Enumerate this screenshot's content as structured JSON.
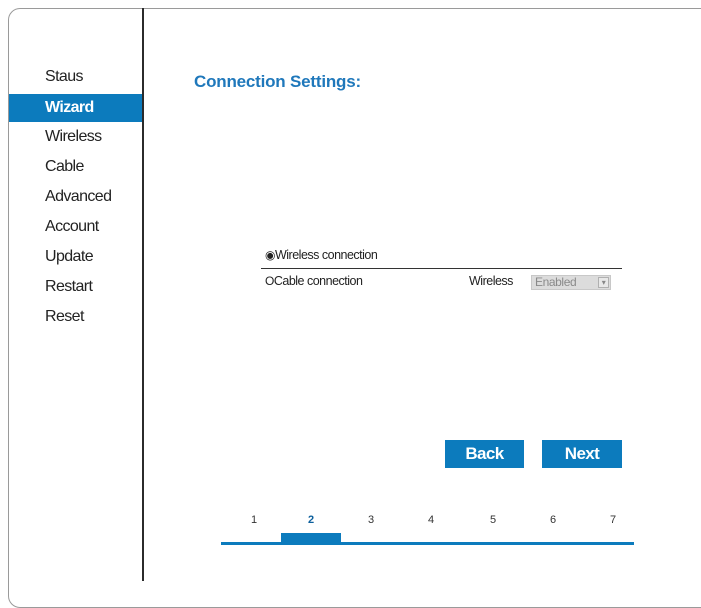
{
  "colors": {
    "accent": "#0c7bbd",
    "title": "#1f78bb",
    "select_bg": "#dcdcdc"
  },
  "sidebar": {
    "items": [
      {
        "label": "Staus",
        "active": false
      },
      {
        "label": "Wizard",
        "active": true
      },
      {
        "label": "Wireless",
        "active": false
      },
      {
        "label": "Cable",
        "active": false
      },
      {
        "label": "Advanced",
        "active": false
      },
      {
        "label": "Account",
        "active": false
      },
      {
        "label": "Update",
        "active": false
      },
      {
        "label": "Restart",
        "active": false
      },
      {
        "label": "Reset",
        "active": false
      }
    ]
  },
  "main": {
    "title": "Connection Settings:",
    "options": [
      {
        "symbol": "◉",
        "label": "Wireless connection",
        "selected": true
      },
      {
        "symbol": "O",
        "label": "Cable connection",
        "selected": false
      }
    ],
    "wireless_field": {
      "label": "Wireless",
      "value": "Enabled"
    },
    "buttons": {
      "back": "Back",
      "next": "Next"
    },
    "steps": [
      "1",
      "2",
      "3",
      "4",
      "5",
      "6",
      "7"
    ],
    "current_step": 2
  }
}
